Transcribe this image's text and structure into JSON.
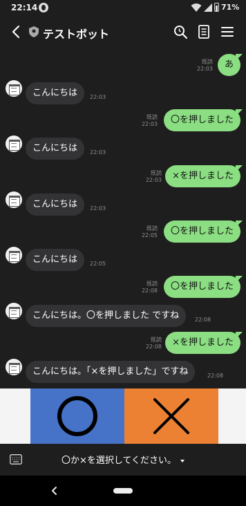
{
  "status_bar": {
    "time": "22:14",
    "battery": "71%",
    "icons": [
      "messaging-app-icon",
      "wifi-icon",
      "signal-icon",
      "battery-icon"
    ]
  },
  "header": {
    "title": "テストボット",
    "icons": [
      "back-arrow-icon",
      "shield-icon",
      "search-icon",
      "notes-icon",
      "menu-icon"
    ]
  },
  "messages": [
    {
      "direction": "out",
      "text": "あ",
      "read": "既読",
      "time": "22:03"
    },
    {
      "direction": "in",
      "text": "こんにちは",
      "time": "22:03"
    },
    {
      "direction": "out",
      "text": "〇を押しました",
      "read": "既読",
      "time": "22:03"
    },
    {
      "direction": "in",
      "text": "こんにちは",
      "time": "22:03"
    },
    {
      "direction": "out",
      "text": "×を押しました",
      "read": "既読",
      "time": "22:03"
    },
    {
      "direction": "in",
      "text": "こんにちは",
      "time": "22:03"
    },
    {
      "direction": "out",
      "text": "〇を押しました",
      "read": "既読",
      "time": "22:05"
    },
    {
      "direction": "in",
      "text": "こんにちは",
      "time": "22:05"
    },
    {
      "direction": "out",
      "text": "〇を押しました",
      "read": "既読",
      "time": "22:08"
    },
    {
      "direction": "in",
      "text": "こんにちは。〇を押しました ですね",
      "time": "22:08"
    },
    {
      "direction": "out",
      "text": "×を押しました",
      "read": "既読",
      "time": "22:08"
    },
    {
      "direction": "in",
      "text": "こんにちは。「×を押しました」ですね",
      "time": "22:08"
    }
  ],
  "choices": {
    "circle": {
      "color": "#4673c8",
      "icon": "circle-icon"
    },
    "cross": {
      "color": "#ec8033",
      "icon": "cross-icon"
    }
  },
  "footer": {
    "label": "〇か×を選択してください。",
    "icons": [
      "keyboard-icon",
      "caret-down-icon"
    ]
  },
  "nav_bar": {
    "icons": [
      "nav-back-icon",
      "home-pill-icon"
    ]
  },
  "colors": {
    "background": "#1e1e1e",
    "outgoing_bubble": "#8bdf82",
    "incoming_bubble": "#333336",
    "meta_text": "#8e8e8e"
  }
}
